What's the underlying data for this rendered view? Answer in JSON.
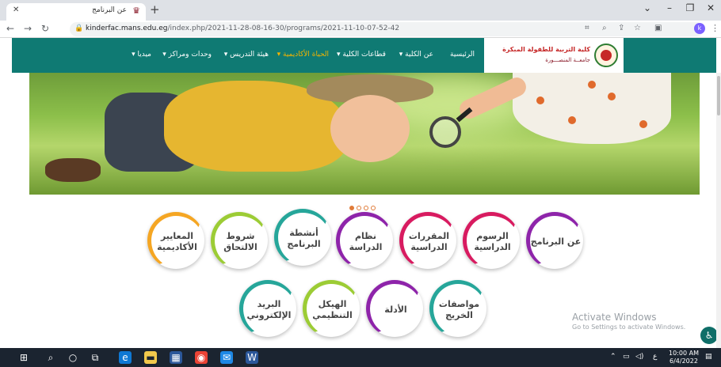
{
  "browser": {
    "tab_title": "عن البرنامج",
    "url_host": "kinderfac.mans.edu.eg",
    "url_path": "/index.php/2021-11-28-08-16-30/programs/2021-11-10-07-52-42",
    "profile_initial": "k"
  },
  "logo": {
    "title": "كلية التربية للطفولة المبكرة",
    "subtitle": "جامعــة المنصـــورة"
  },
  "nav": {
    "items": [
      {
        "label": "الرئيسية"
      },
      {
        "label": "عن الكلية ▾"
      },
      {
        "label": "قطاعات الكلية ▾"
      },
      {
        "label": "الحياة الأكاديمية ▾"
      },
      {
        "label": "هيئة التدريس ▾"
      },
      {
        "label": "وحدات ومراكز ▾"
      },
      {
        "label": "ميديا ▾"
      }
    ],
    "active_index": 3
  },
  "slider": {
    "dots": 4,
    "active": 0
  },
  "menu_row1": [
    {
      "label": "عن البرنامج",
      "color": "purple"
    },
    {
      "label": "الرسوم الدراسية",
      "color": "pink"
    },
    {
      "label": "المقررات الدراسية",
      "color": "pink"
    },
    {
      "label": "نظام الدراسة",
      "color": "purple"
    },
    {
      "label": "أنشطة البرنامج",
      "color": "teal"
    },
    {
      "label": "شروط الالتحاق",
      "color": "green"
    },
    {
      "label": "المعايير الأكاديمية",
      "color": "orange"
    }
  ],
  "menu_row2": [
    {
      "label": "مواصفات الخريج",
      "color": "teal"
    },
    {
      "label": "الأدلة",
      "color": "purple"
    },
    {
      "label": "الهيكل التنظيمي",
      "color": "green"
    },
    {
      "label": "البريد الإلكتروني",
      "color": "teal"
    }
  ],
  "watermark": {
    "title": "Activate Windows",
    "subtitle": "Go to Settings to activate Windows."
  },
  "taskbar": {
    "time": "10:00 AM",
    "date": "6/4/2022",
    "lang": "ع"
  },
  "colors": {
    "header_teal": "#0f7a73",
    "active_nav": "#f4b400",
    "taskbar": "#1b2430"
  }
}
